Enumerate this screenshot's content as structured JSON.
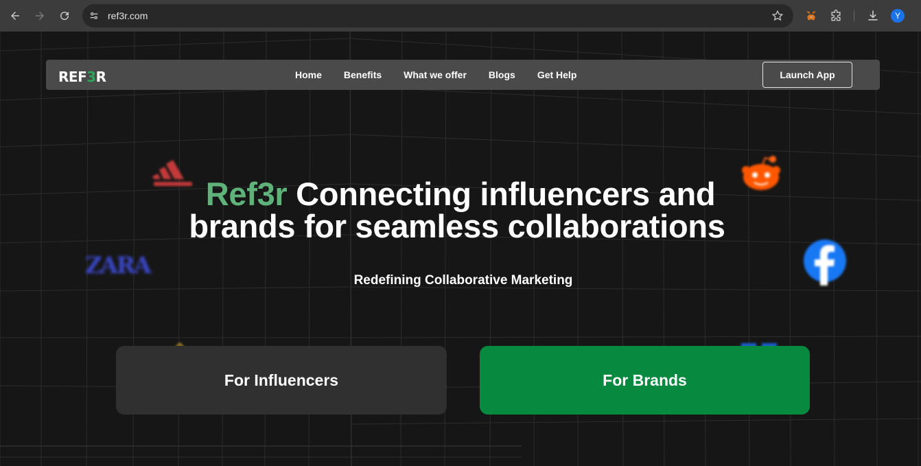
{
  "browser": {
    "url": "ref3r.com",
    "profile_initial": "Y"
  },
  "nav": {
    "logo": {
      "pre": "REF",
      "accent": "3",
      "post": "R"
    },
    "links": [
      "Home",
      "Benefits",
      "What we offer",
      "Blogs",
      "Get Help"
    ],
    "launch_label": "Launch App"
  },
  "hero": {
    "brand": "Ref3r",
    "title_rest_line1": " Connecting influencers and",
    "title_line2": "brands for seamless collaborations",
    "subtitle": "Redefining Collaborative Marketing"
  },
  "cta": {
    "influencers": "For Influencers",
    "brands": "For Brands"
  },
  "floating_logos": {
    "zara": "ZARA"
  },
  "colors": {
    "accent_green": "#5fb27a",
    "brand_button": "#078a3f",
    "influencer_button": "#303030",
    "nav_bg": "#4a4a4a",
    "page_bg": "#161616"
  }
}
